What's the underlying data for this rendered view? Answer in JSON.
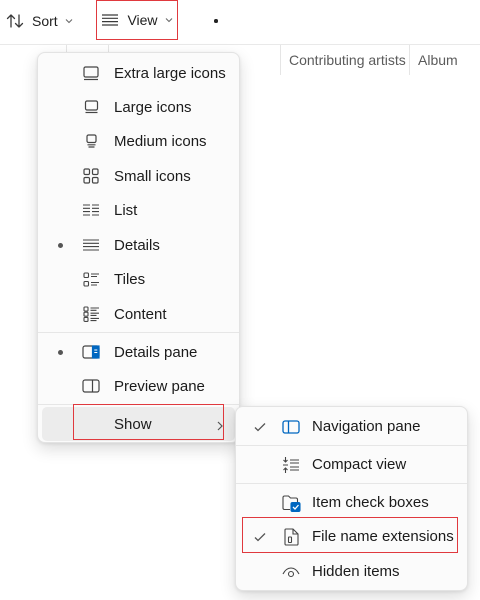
{
  "toolbar": {
    "sort_label": "Sort",
    "view_label": "View",
    "sort_icon": "sort-arrows-icon",
    "view_icon": "view-lines-icon",
    "more_icon": "more-dots-icon"
  },
  "columns": {
    "artists": "Contributing artists",
    "album": "Album"
  },
  "view_menu": {
    "items": [
      {
        "label": "Extra large icons",
        "icon": "extra-large-icons-icon",
        "selected": false
      },
      {
        "label": "Large icons",
        "icon": "large-icons-icon",
        "selected": false
      },
      {
        "label": "Medium icons",
        "icon": "medium-icons-icon",
        "selected": false
      },
      {
        "label": "Small icons",
        "icon": "small-icons-icon",
        "selected": false
      },
      {
        "label": "List",
        "icon": "list-icon",
        "selected": false
      },
      {
        "label": "Details",
        "icon": "details-icon",
        "selected": true
      },
      {
        "label": "Tiles",
        "icon": "tiles-icon",
        "selected": false
      },
      {
        "label": "Content",
        "icon": "content-icon",
        "selected": false
      }
    ],
    "pane_items": [
      {
        "label": "Details pane",
        "icon": "details-pane-icon",
        "selected": true
      },
      {
        "label": "Preview pane",
        "icon": "preview-pane-icon",
        "selected": false
      }
    ],
    "show_label": "Show"
  },
  "show_menu": {
    "items": [
      {
        "label": "Navigation pane",
        "icon": "navigation-pane-icon",
        "checked": true
      },
      {
        "label": "Compact view",
        "icon": "compact-view-icon",
        "checked": false
      },
      {
        "label": "Item check boxes",
        "icon": "item-check-boxes-icon",
        "checked": false
      },
      {
        "label": "File name extensions",
        "icon": "file-extension-icon",
        "checked": true
      },
      {
        "label": "Hidden items",
        "icon": "hidden-items-icon",
        "checked": false
      }
    ]
  },
  "colors": {
    "highlight_border": "#e0393e",
    "accent": "#0067c0"
  }
}
